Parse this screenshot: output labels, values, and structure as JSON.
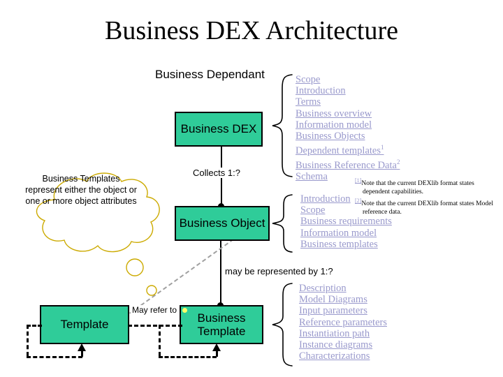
{
  "slide": {
    "title": "Business DEX Architecture",
    "background_color": "#ffffff"
  },
  "palette": {
    "box_fill": "#2FCC99",
    "box_border": "#000000",
    "link_color": "#9999CC",
    "cloud_stroke": "#CCAA00",
    "dashed_grey": "#A0A0A0",
    "yellow_dot": "#FFFF66"
  },
  "headings": {
    "business_dependant": "Business Dependant"
  },
  "boxes": {
    "business_dex": "Business DEX",
    "business_object": "Business Object",
    "template": "Template",
    "business_template_line1": "Business",
    "business_template_line2": "Template"
  },
  "connectors": {
    "collects": "Collects 1:?",
    "may_be_represented_by": "may be represented by 1:?",
    "may_refer_to": "May refer to"
  },
  "cloud": {
    "line1": "Business",
    "line2": "Templates",
    "line3": "represent either",
    "line4": "the object or one",
    "line5": "or more object",
    "line6": "attributes"
  },
  "lists": {
    "business_dex": [
      {
        "label": "Scope",
        "note": ""
      },
      {
        "label": "Introduction",
        "note": ""
      },
      {
        "label": "Terms",
        "note": ""
      },
      {
        "label": "Business overview",
        "note": ""
      },
      {
        "label": "Information model",
        "note": ""
      },
      {
        "label": "Business Objects",
        "note": ""
      },
      {
        "label": "Dependent templates",
        "note": "1"
      },
      {
        "label": "Business Reference Data",
        "note": "2"
      },
      {
        "label": "Schema",
        "note": ""
      }
    ],
    "business_object": [
      {
        "label": "Introduction",
        "note": ""
      },
      {
        "label": "Scope",
        "note": ""
      },
      {
        "label": "Business requirements",
        "note": ""
      },
      {
        "label": "Information model",
        "note": ""
      },
      {
        "label": "Business templates",
        "note": ""
      }
    ],
    "business_template": [
      {
        "label": "Description",
        "note": ""
      },
      {
        "label": "Model Diagrams",
        "note": ""
      },
      {
        "label": "Input parameters",
        "note": ""
      },
      {
        "label": "Reference parameters",
        "note": ""
      },
      {
        "label": "Instantiation path",
        "note": ""
      },
      {
        "label": "Instance diagrams",
        "note": ""
      },
      {
        "label": "Characterizations",
        "note": ""
      }
    ]
  },
  "footnotes": [
    {
      "num": "1",
      "text": "Note that the current DEXlib format states dependent capabilities."
    },
    {
      "num": "2",
      "text": "Note that the current DEXlib format states Model reference data."
    }
  ]
}
